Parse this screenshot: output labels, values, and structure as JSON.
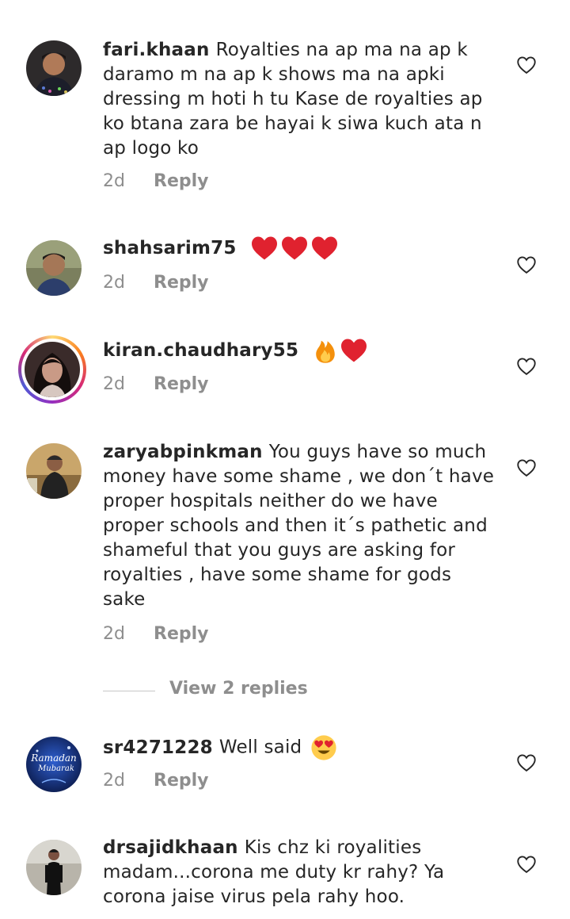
{
  "comments": [
    {
      "username": "fari.khaan",
      "text": "Royalties na ap ma na ap k daramo m na ap k shows ma na apki dressing m hoti h tu Kase de royalties ap ko btana zara be hayai k siwa kuch ata n ap logo ko",
      "time": "2d",
      "reply_label": "Reply"
    },
    {
      "username": "shahsarim75",
      "text": "",
      "emojis": [
        "red-heart",
        "red-heart",
        "red-heart"
      ],
      "time": "2d",
      "reply_label": "Reply"
    },
    {
      "username": "kiran.chaudhary55",
      "text": "",
      "emojis": [
        "fire",
        "red-heart"
      ],
      "time": "2d",
      "reply_label": "Reply"
    },
    {
      "username": "zaryabpinkman",
      "text": "You guys have so much money have some shame , we don´t have proper hospitals neither do we have proper schools and then it´s pathetic and shameful that you guys are asking for royalties , have some shame for gods sake",
      "time": "2d",
      "reply_label": "Reply"
    },
    {
      "username": "sr4271228",
      "text": "Well said",
      "emojis": [
        "heart-eyes"
      ],
      "time": "2d",
      "reply_label": "Reply",
      "avatar_text": [
        "Ramadan",
        "Mubarak"
      ]
    },
    {
      "username": "drsajidkhaan",
      "text": "Kis chz ki royalities madam...corona me duty kr rahy? Ya corona jaise virus pela rahy hoo.",
      "time": "",
      "reply_label": ""
    }
  ],
  "view_replies_label": "View 2 replies",
  "colors": {
    "text": "#262626",
    "meta": "#8e8e8e",
    "heart_emoji": "#e0222f",
    "divider": "#c7c7c7"
  }
}
